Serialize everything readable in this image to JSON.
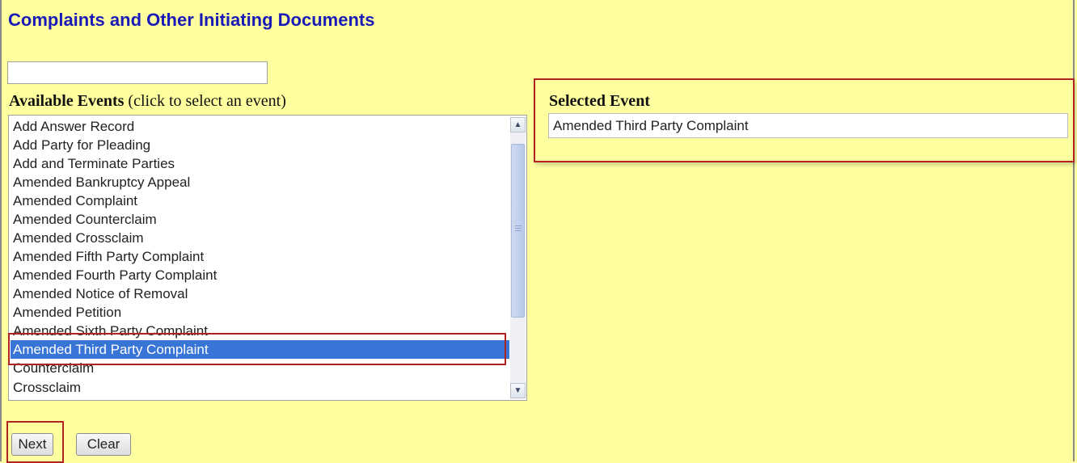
{
  "page": {
    "title": "Complaints and Other Initiating Documents"
  },
  "search": {
    "value": ""
  },
  "available_events": {
    "label_bold": "Available Events",
    "label_hint": "(click to select an event)",
    "items": [
      "Add Answer Record",
      "Add Party for Pleading",
      "Add and Terminate Parties",
      "Amended Bankruptcy Appeal",
      "Amended Complaint",
      "Amended Counterclaim",
      "Amended Crossclaim",
      "Amended Fifth Party Complaint",
      "Amended Fourth Party Complaint",
      "Amended Notice of Removal",
      "Amended Petition",
      "Amended Sixth Party Complaint",
      "Amended Third Party Complaint",
      "Counterclaim",
      "Crossclaim"
    ],
    "selected_index": 12
  },
  "selected_event": {
    "label": "Selected Event",
    "value": "Amended Third Party Complaint"
  },
  "buttons": {
    "next_label": "Next",
    "clear_label": "Clear"
  },
  "icons": {
    "scroll_up": "chevron-up-icon",
    "scroll_down": "chevron-down-icon"
  },
  "colors": {
    "background": "#ffffa0",
    "title": "#1a1ab8",
    "selection": "#3875d7",
    "annotation_highlight": "#b22222"
  }
}
